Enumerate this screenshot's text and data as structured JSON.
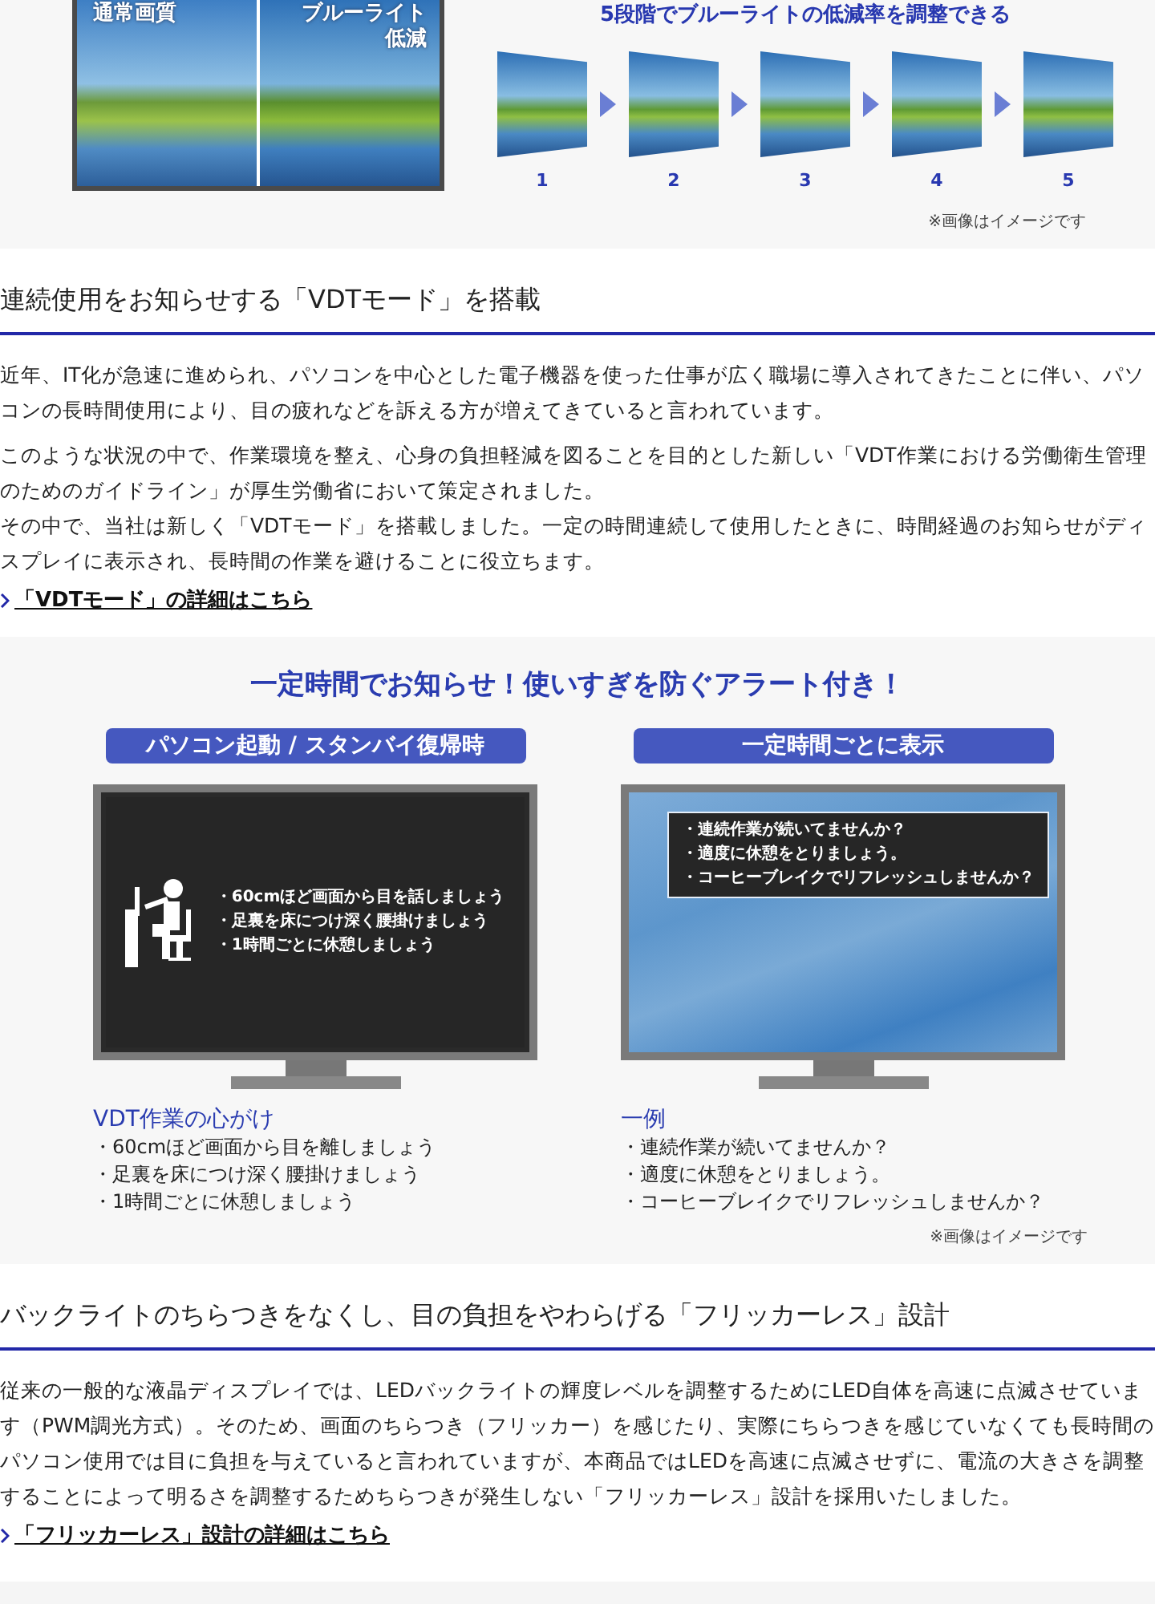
{
  "blue_light_panel": {
    "comparison_labels": [
      "通常画質",
      "ブルーライト低減"
    ],
    "title": "5段階でブルーライトの低減率を調整できる",
    "steps": [
      "1",
      "2",
      "3",
      "4",
      "5"
    ],
    "note": "※画像はイメージです"
  },
  "vdt_section": {
    "heading": "連続使用をお知らせする「VDTモード」を搭載",
    "paragraphs": [
      [
        "近年、IT化が急速に進められ、パソコンを中心とした電子機器を使った仕事が広く職場に導入されてきたことに伴い、パソコンの長時間使用により、目の疲れなどを訴える方が増えてきていると言われています。"
      ],
      [
        "このような状況の中で、作業環境を整え、心身の負担軽減を図ることを目的とした新しい「VDT作業における労働衛生管理のためのガイドライン」が厚生労働省において策定されました。",
        "その中で、当社は新しく「VDTモード」を搭載しました。一定の時間連続して使用したときに、時間経過のお知らせがディスプレイに表示され、長時間の作業を避けることに役立ちます。"
      ]
    ],
    "link": "「VDTモード」の詳細はこちら"
  },
  "alert_panel": {
    "title": "一定時間でお知らせ！使いすぎを防ぐアラート付き！",
    "columns": [
      {
        "tag": "パソコン起動 / スタンバイ復帰時",
        "screen": {
          "kind": "desk",
          "lines": [
            "・60cmほど画面から目を話しましょう",
            "・足裏を床につけ深く腰掛けましょう",
            "・1時間ごとに休憩しましょう"
          ]
        },
        "heading": "VDT作業の心がけ",
        "items": [
          "・60cmほど画面から目を離しましょう",
          "・足裏を床につけ深く腰掛けましょう",
          "・1時間ごとに休憩しましょう"
        ]
      },
      {
        "tag": "一定時間ごとに表示",
        "screen": {
          "kind": "popup",
          "lines": [
            "・連続作業が続いてませんか？",
            "・適度に休憩をとりましょう。",
            "・コーヒーブレイクでリフレッシュしませんか？"
          ]
        },
        "heading": "一例",
        "items": [
          "・連続作業が続いてませんか？",
          "・適度に休憩をとりましょう。",
          "・コーヒーブレイクでリフレッシュしませんか？"
        ]
      }
    ],
    "note": "※画像はイメージです"
  },
  "flicker_section": {
    "heading": "バックライトのちらつきをなくし、目の負担をやわらげる「フリッカーレス」設計",
    "paragraphs": [
      [
        "従来の一般的な液晶ディスプレイでは、LEDバックライトの輝度レベルを調整するためにLED自体を高速に点滅させています（PWM調光方式）。そのため、画面のちらつき（フリッカー）を感じたり、実際にちらつきを感じていなくても長時間のパソコン使用では目に負担を与えていると言われていますが、本商品ではLEDを高速に点滅させずに、電流の大きさを調整することによって明るさを調整するためちらつきが発生しない「フリッカーレス」設計を採用いたしました。"
      ]
    ],
    "link": "「フリッカーレス」設計の詳細はこちら"
  }
}
